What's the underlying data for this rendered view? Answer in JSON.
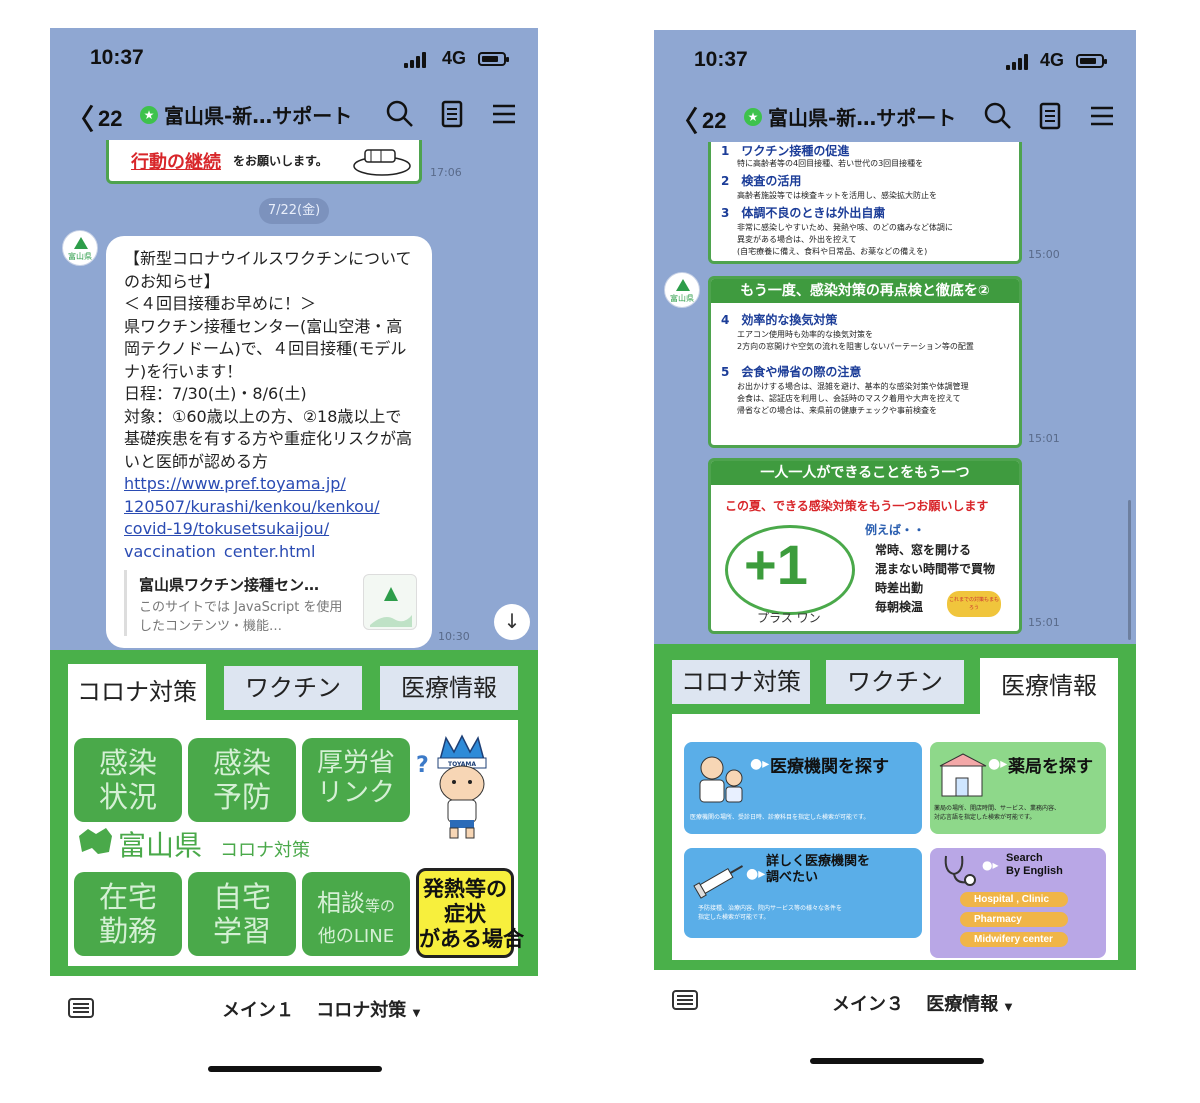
{
  "left": {
    "status": {
      "time": "10:37",
      "network": "4G"
    },
    "header": {
      "back_count": "22",
      "title": "富山県-新…サポート"
    },
    "top_banner": {
      "text_red": "行動の継続",
      "text_black": "をお願いします。",
      "time": "17:06"
    },
    "date_chip": "7/22(金)",
    "avatar_label": "富山県",
    "message": {
      "text": "【新型コロナウイルスワクチンについてのお知らせ】\n＜４回目接種お早めに！＞\n県ワクチン接種センター(富山空港・高岡テクノドーム)で、４回目接種(モデルナ)を行います！\n日程：7/30(土)・8/6(土)\n対象：①60歳以上の方、②18歳以上で基礎疾患を有する方や重症化リスクが高いと医師が認める方",
      "link": "https://www.pref.toyama.jp/120507/kurashi/kenkou/kenkou/covid-19/tokusetsukaijou/vaccination_center.html",
      "link_lines": [
        "https://www.pref.toyama.jp/",
        "120507/kurashi/kenkou/kenkou/",
        "covid-19/tokusetsukaijou/",
        "vaccination_center.html"
      ],
      "preview_title": "富山県ワクチン接種セン…",
      "preview_desc": "このサイトでは JavaScript を使用したコンテンツ・機能…",
      "time": "10:30"
    },
    "menu": {
      "tabs": [
        "コロナ対策",
        "ワクチン",
        "医療情報"
      ],
      "active_tab": 0,
      "buttons": {
        "kansen_joukyou": "感染\n状況",
        "kansen_yobou": "感染\n予防",
        "kouroushou": "厚労省\nリンク",
        "zaitaku": "在宅\n勤務",
        "jitaku": "自宅\n学習",
        "soudan_main": "相談",
        "soudan_small": "等の",
        "soudan_line": "他のLINE",
        "hatsunetsu": "発熱等の\n症状\nがある場合"
      },
      "brand_pref": "富山県",
      "brand_sub": "コロナ対策",
      "mascot_label": "TOYAMA"
    },
    "bottom": {
      "menu_name": "メイン１",
      "menu_category": "コロナ対策"
    }
  },
  "right": {
    "status": {
      "time": "10:37",
      "network": "4G"
    },
    "header": {
      "back_count": "22",
      "title": "富山県-新…サポート"
    },
    "card1": {
      "items": [
        {
          "num": "1",
          "title": "ワクチン接種の促進",
          "desc": "特に高齢者等の4回目接種、若い世代の3回目接種を"
        },
        {
          "num": "2",
          "title": "検査の活用",
          "desc": "高齢者施設等では検査キットを活用し、感染拡大防止を"
        },
        {
          "num": "3",
          "title": "体調不良のときは外出自粛",
          "desc": "非常に感染しやすいため、発熱や咳、のどの痛みなど体調に\n異変がある場合は、外出を控えて\n(自宅療養に備え、食料や日常品、お薬などの備えを)"
        }
      ],
      "time": "15:00"
    },
    "card2": {
      "band": "もう一度、感染対策の再点検と徹底を②",
      "items": [
        {
          "num": "4",
          "title": "効率的な換気対策",
          "desc": "エアコン使用時も効率的な換気対策を\n2方向の窓開けや空気の流れを阻害しないパーテーション等の配置"
        },
        {
          "num": "5",
          "title": "会食や帰省の際の注意",
          "desc": "お出かけする場合は、混雑を避け、基本的な感染対策や体調管理\n会食は、認証店を利用し、会話時のマスク着用や大声を控えて\n帰省などの場合は、来県前の健康チェックや事前検査を"
        }
      ],
      "time": "15:01"
    },
    "card3": {
      "band": "一人一人ができることをもう一つ",
      "headline": "この夏、できる感染対策をもう一つお願いします",
      "plus": "+1",
      "plus_label": "プラス ワン",
      "examples_title": "例えば・・",
      "examples": [
        "常時、窓を開ける",
        "混まない時間帯で買物",
        "時差出勤",
        "毎朝検温"
      ],
      "badge": "これまでの対策もまもろう",
      "time": "15:01"
    },
    "avatar_label": "富山県",
    "menu": {
      "tabs": [
        "コロナ対策",
        "ワクチン",
        "医療情報"
      ],
      "active_tab": 2,
      "cards": {
        "iryou": {
          "title": "医療機関を探す",
          "desc": "医療機関の場所、受診日時、診療科目を指定した検索が可能です。"
        },
        "yakkyoku": {
          "title": "薬局を探す",
          "desc": "薬局の場所、開店時間、サービス、業務内容、\n対応言語を指定した検索が可能です。"
        },
        "kuwashiku": {
          "title": "詳しく医療機関を\n調べたい",
          "desc": "予防接種、治療内容、院内サービス等の様々な条件を\n指定した検索が可能です。"
        },
        "english": {
          "title": "Search\nBy English",
          "options": [
            "Hospital , Clinic",
            "Pharmacy",
            "Midwifery center"
          ]
        }
      }
    },
    "bottom": {
      "menu_name": "メイン３",
      "menu_category": "医療情報"
    }
  },
  "colors": {
    "chat_bg": "#8fa7d2",
    "menu_green": "#4ab04a",
    "link": "#2a4bb3",
    "alert_yellow": "#f7ef3d"
  }
}
